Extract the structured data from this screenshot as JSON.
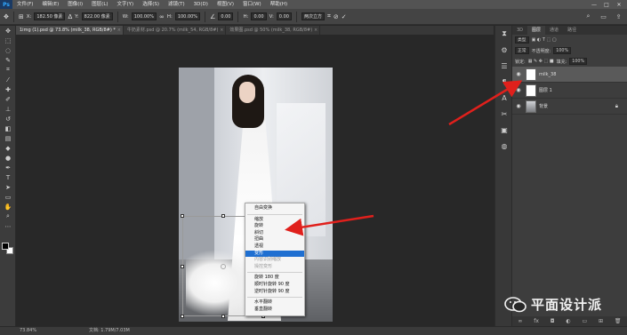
{
  "app": {
    "logo": "Ps"
  },
  "menu": [
    "文件(F)",
    "编辑(E)",
    "图像(I)",
    "图层(L)",
    "文字(Y)",
    "选择(S)",
    "滤镜(T)",
    "3D(D)",
    "视图(V)",
    "窗口(W)",
    "帮助(H)"
  ],
  "window_controls": [
    "—",
    "□",
    "✕"
  ],
  "options": {
    "x_label": "X:",
    "x_value": "182.50 像素",
    "y_label": "Y:",
    "y_value": "822.00 像素",
    "w_label": "W:",
    "w_value": "100.00%",
    "h_label": "H:",
    "h_value": "100.00%",
    "angle_value": "0.00",
    "h2_label": "H:",
    "h2_value": "0.00",
    "v_label": "V:",
    "v_value": "0.00",
    "interp_value": "两次立方",
    "icons": [
      "warp-icon",
      "cancel-icon",
      "commit-icon"
    ]
  },
  "tabs": [
    {
      "label": "1img (1).psd @ 73.8% (milk_38, RGB/8#) *",
      "active": true
    },
    {
      "label": "牛奶素材.psd @ 20.7% (milk_54, RGB/8#)",
      "active": false
    },
    {
      "label": "效果图.psd @ 50% (milk_38, RGB/8#)",
      "active": false
    }
  ],
  "context_menu": {
    "items": [
      {
        "label": "自由变换",
        "state": "normal"
      },
      {
        "sep": true
      },
      {
        "label": "缩放",
        "state": "normal"
      },
      {
        "label": "旋转",
        "state": "normal"
      },
      {
        "label": "斜切",
        "state": "normal"
      },
      {
        "label": "扭曲",
        "state": "normal"
      },
      {
        "label": "透视",
        "state": "normal"
      },
      {
        "label": "变形",
        "state": "selected"
      },
      {
        "label": "内容识别缩放",
        "state": "disabled"
      },
      {
        "label": "操控变形",
        "state": "disabled"
      },
      {
        "sep": true
      },
      {
        "label": "旋转 180 度",
        "state": "normal"
      },
      {
        "label": "顺时针旋转 90 度",
        "state": "normal"
      },
      {
        "label": "逆时针旋转 90 度",
        "state": "normal"
      },
      {
        "sep": true
      },
      {
        "label": "水平翻转",
        "state": "normal"
      },
      {
        "label": "垂直翻转",
        "state": "normal"
      }
    ]
  },
  "panel": {
    "tabs": [
      "3D",
      "图层",
      "通道",
      "路径"
    ],
    "kind_filter": "类型",
    "blend_mode": "正常",
    "opacity_label": "不透明度:",
    "opacity_value": "100%",
    "lock_label": "锁定:",
    "fill_label": "填充:",
    "fill_value": "100%",
    "layers": [
      {
        "name": "milk_38",
        "selected": true,
        "thumb": "white"
      },
      {
        "name": "图层 1",
        "selected": false,
        "thumb": "white"
      },
      {
        "name": "背景",
        "selected": false,
        "thumb": "photo",
        "locked": true
      }
    ]
  },
  "status": {
    "zoom": "73.84%",
    "doc": "文档: 1.79M/7.03M"
  },
  "watermark": {
    "text": "平面设计派"
  },
  "colors": {
    "accent": "#1f6fd1",
    "arrow": "#e0201c"
  }
}
